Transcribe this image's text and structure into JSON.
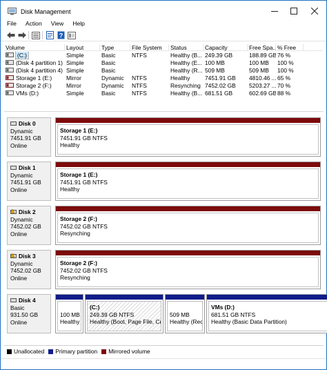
{
  "window": {
    "title": "Disk Management"
  },
  "menu": [
    "File",
    "Action",
    "View",
    "Help"
  ],
  "toolbar": [
    "back",
    "forward",
    "disk-list",
    "properties",
    "help",
    "disk-view"
  ],
  "volume_list": {
    "columns": [
      "Volume",
      "Layout",
      "Type",
      "File System",
      "Status",
      "Capacity",
      "Free Spa...",
      "% Free"
    ],
    "rows": [
      {
        "volume": "(C:)",
        "layout": "Simple",
        "type": "Basic",
        "fs": "NTFS",
        "status": "Healthy (B...",
        "capacity": "249.39 GB",
        "free": "188.89 GB",
        "pct": "76 %",
        "selected": true,
        "icon_color": "#5a5a5a"
      },
      {
        "volume": "(Disk 4 partition 1)",
        "layout": "Simple",
        "type": "Basic",
        "fs": "",
        "status": "Healthy (E...",
        "capacity": "100 MB",
        "free": "100 MB",
        "pct": "100 %",
        "selected": false,
        "icon_color": "#5a5a5a"
      },
      {
        "volume": "(Disk 4 partition 4)",
        "layout": "Simple",
        "type": "Basic",
        "fs": "",
        "status": "Healthy (R...",
        "capacity": "509 MB",
        "free": "509 MB",
        "pct": "100 %",
        "selected": false,
        "icon_color": "#5a5a5a"
      },
      {
        "volume": "Storage 1 (E:)",
        "layout": "Mirror",
        "type": "Dynamic",
        "fs": "NTFS",
        "status": "Healthy",
        "capacity": "7451.91 GB",
        "free": "4810.46 ...",
        "pct": "65 %",
        "selected": false,
        "icon_color": "#7a1a1a"
      },
      {
        "volume": "Storage 2 (F:)",
        "layout": "Mirror",
        "type": "Dynamic",
        "fs": "NTFS",
        "status": "Resynching",
        "capacity": "7452.02 GB",
        "free": "5203.27 ...",
        "pct": "70 %",
        "selected": false,
        "icon_color": "#7a1a1a"
      },
      {
        "volume": "VMs (D:)",
        "layout": "Simple",
        "type": "Basic",
        "fs": "NTFS",
        "status": "Healthy (B...",
        "capacity": "681.51 GB",
        "free": "602.69 GB",
        "pct": "88 %",
        "selected": false,
        "icon_color": "#5a5a5a"
      }
    ]
  },
  "disks": [
    {
      "name": "Disk 0",
      "kind": "Dynamic",
      "size": "7451.91 GB",
      "state": "Online",
      "warn_icon": false,
      "partitions": [
        {
          "title": "Storage 1  (E:)",
          "line2": "7451.91 GB NTFS",
          "line3": "Healthy",
          "bar": "mirrored",
          "hatched": false
        }
      ]
    },
    {
      "name": "Disk 1",
      "kind": "Dynamic",
      "size": "7451.91 GB",
      "state": "Online",
      "warn_icon": false,
      "partitions": [
        {
          "title": "Storage 1  (E:)",
          "line2": "7451.91 GB NTFS",
          "line3": "Healthy",
          "bar": "mirrored",
          "hatched": false
        }
      ]
    },
    {
      "name": "Disk 2",
      "kind": "Dynamic",
      "size": "7452.02 GB",
      "state": "Online",
      "warn_icon": true,
      "partitions": [
        {
          "title": "Storage 2  (F:)",
          "line2": "7452.02 GB NTFS",
          "line3": "Resynching",
          "bar": "mirrored",
          "hatched": false
        }
      ]
    },
    {
      "name": "Disk 3",
      "kind": "Dynamic",
      "size": "7452.02 GB",
      "state": "Online",
      "warn_icon": true,
      "partitions": [
        {
          "title": "Storage 2  (F:)",
          "line2": "7452.02 GB NTFS",
          "line3": "Resynching",
          "bar": "mirrored",
          "hatched": false
        }
      ]
    },
    {
      "name": "Disk 4",
      "kind": "Basic",
      "size": "931.50 GB",
      "state": "Online",
      "warn_icon": false,
      "partitions": [
        {
          "title": "",
          "line2": "100 MB",
          "line3": "Healthy (",
          "bar": "primary",
          "hatched": false
        },
        {
          "title": "(C:)",
          "line2": "249.39 GB NTFS",
          "line3": "Healthy (Boot, Page File, Crash",
          "bar": "primary",
          "hatched": true
        },
        {
          "title": "",
          "line2": "509 MB",
          "line3": "Healthy (Recc",
          "bar": "primary",
          "hatched": false
        },
        {
          "title": "VMs  (D:)",
          "line2": "681.51 GB NTFS",
          "line3": "Healthy (Basic Data Partition)",
          "bar": "primary",
          "hatched": false
        }
      ]
    }
  ],
  "legend": [
    {
      "label": "Unallocated",
      "color": "#000000"
    },
    {
      "label": "Primary partition",
      "color": "#0f1d8a"
    },
    {
      "label": "Mirrored volume",
      "color": "#7d0a0a"
    }
  ],
  "colors": {
    "mirrored": "#7d0a0a",
    "primary": "#0f1d8a"
  }
}
